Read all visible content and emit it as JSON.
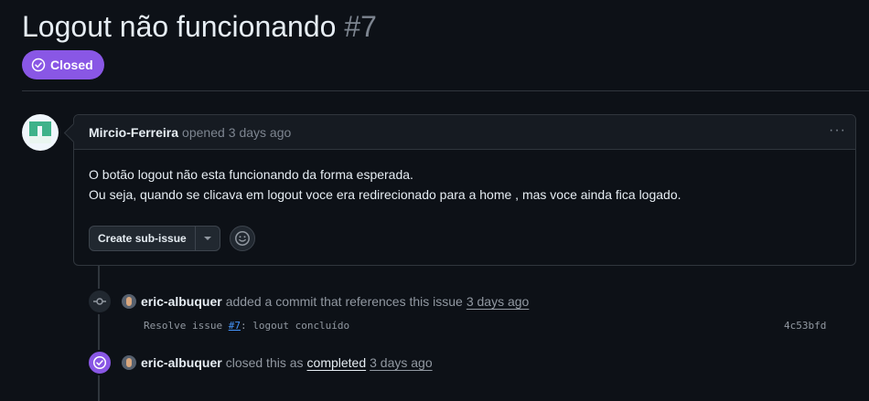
{
  "issue": {
    "title": "Logout não funcionando",
    "number": "#7",
    "state_label": "Closed"
  },
  "comment": {
    "author": "Mircio-Ferreira",
    "action": "opened",
    "time": "3 days ago",
    "body_line1": "O botão logout não esta funcionando da forma esperada.",
    "body_line2": "Ou seja, quando se clicava em logout voce era redirecionado para a home , mas voce ainda fica logado.",
    "create_subissue_label": "Create sub-issue",
    "menu_glyph": "···"
  },
  "timeline": {
    "commit_event": {
      "actor": "eric-albuquer",
      "text": "added a commit that references this issue",
      "time": "3 days ago",
      "commit_message_prefix": "Resolve issue ",
      "commit_issue_ref": "#7",
      "commit_message_suffix": ": logout concluído",
      "sha": "4c53bfd"
    },
    "closed_event": {
      "actor": "eric-albuquer",
      "text_before": "closed this as",
      "reason": "completed",
      "time": "3 days ago"
    }
  },
  "colors": {
    "background": "#0d1117",
    "closed_purple": "#8957e5",
    "link_blue": "#4493f8"
  }
}
